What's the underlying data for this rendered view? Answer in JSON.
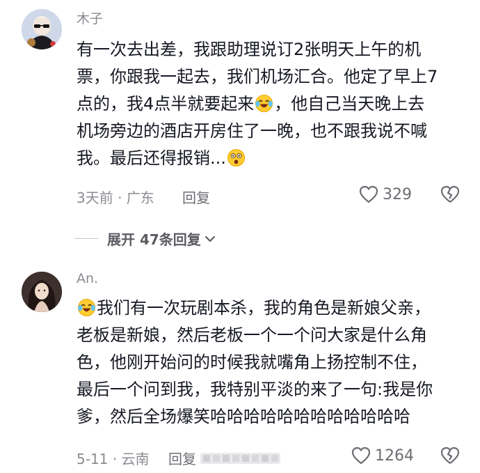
{
  "comments": [
    {
      "user": "木子",
      "lines": [
        "有一次去出差，我跟助理说订2张明天上午的机",
        "票，你跟我一起去，我们机场汇合。他定了早上7",
        "点的，我4点半就要起来[EMOJI]，他自己当天晚上去",
        "机场旁边的酒店开房住了一晚，也不跟我说不喊",
        "我。最后还得报销...[EMOJI]"
      ],
      "emojis": [
        "crying-laughing-emoji-icon",
        "surprised-face-emoji-icon"
      ],
      "meta": "3天前 · 广东",
      "reply_label": "回复",
      "likes": "329"
    },
    {
      "user": "An.",
      "lines": [
        "[EMOJI]我们有一次玩剧本杀，我的角色是新娘父亲，",
        "老板是新娘，然后老板一个一个问大家是什么角",
        "色，他刚开始问的时候我就嘴角上扬控制不住，",
        "最后一个问到我，我特别平淡的来了一句:我是你",
        "爹，然后全场爆笑哈哈哈哈哈哈哈哈哈哈哈哈"
      ],
      "emojis": [
        "crying-laughing-emoji-icon"
      ],
      "meta": "5-11 · 云南",
      "reply_label": "回复",
      "likes": "1264"
    }
  ],
  "expand_replies": "展开 47条回复",
  "colors": {
    "text": "#161823",
    "muted": "#8a8b91",
    "icon": "#6c6d73"
  }
}
